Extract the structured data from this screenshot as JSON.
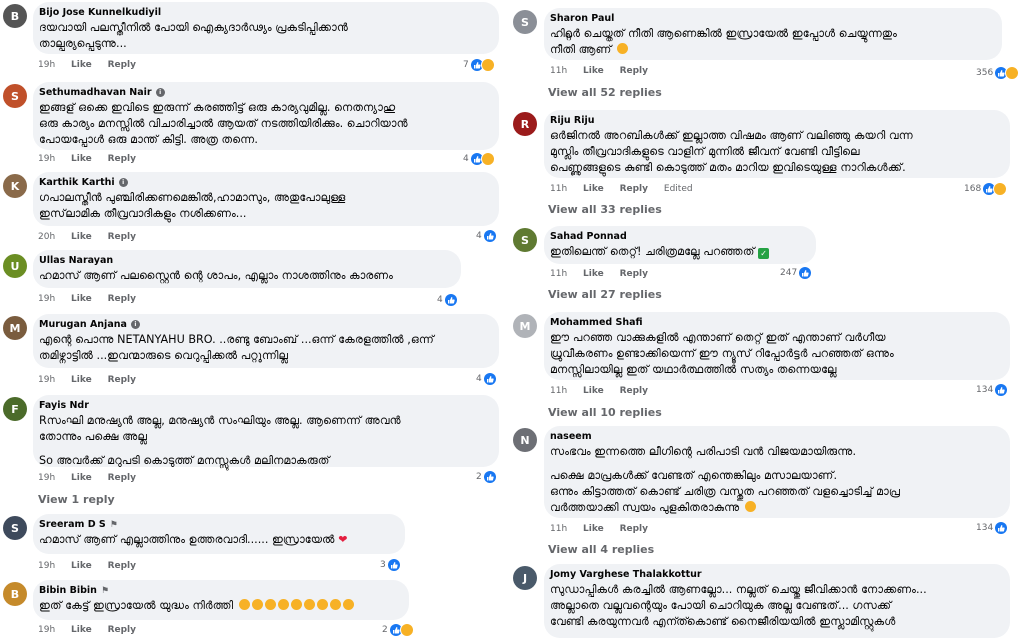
{
  "actions": {
    "like": "Like",
    "reply": "Reply",
    "edited": "Edited"
  },
  "colors": {
    "like_blue": "#1877f2",
    "haha_yellow": "#f7b125",
    "meta_gray": "#65676b",
    "bubble_bg": "#f0f2f5"
  },
  "left": [
    {
      "name": "Bijo Jose Kunnelkudiyil",
      "lines": [
        "ദയവായി പലസ്തീനിൽ പോയി ഐക്യദാർഢ്യം പ്രകടിപ്പിക്കാൻ",
        "താല്പര്യപ്പെടുന്നു..."
      ],
      "time": "19h",
      "count": "7",
      "icons": [
        "like-icon",
        "haha-icon"
      ]
    },
    {
      "name": "Sethumadhavan Nair",
      "lines": [
        "ഇങ്ങള് ഒക്കെ ഇവിടെ ഇരുന്ന് കരഞ്ഞിട്ട് ഒരു കാര്യവുമില്ല. നെതന്യാഹു",
        "ഒരു കാര്യം മനസ്സിൽ വിചാരിച്ചാൽ ആയത് നടത്തിയിരിക്കും. ചൊറിയാൻ",
        "പോയപ്പോൾ ഒരു മാന്ത് കിട്ടി. അത്ര തന്നെ."
      ],
      "time": "19h",
      "count": "4",
      "icons": [
        "like-icon",
        "haha-icon"
      ]
    },
    {
      "name": "Karthik Karthi",
      "lines": [
        "ഗപാലസ്തീൻ പുഞ്ചിരിക്കണമെങ്കിൽ,ഹാമാസും, അതുപോലുള്ള",
        "ഇസ്‌ലാമിക തീവ്രവാദികളും നശിക്കണം..."
      ],
      "time": "20h",
      "count": "4",
      "icons": [
        "like-icon"
      ]
    },
    {
      "name": "Ullas Narayan",
      "lines": [
        "ഹമാസ് ആണ് പലസ്റ്റൈൻ ന്റെ ശാപം, എല്ലാം നാശത്തിനും കാരണം"
      ],
      "time": "19h",
      "count": "4",
      "icons": [
        "like-icon"
      ]
    },
    {
      "name": "Murugan Anjana",
      "lines": [
        "എന്റെ പൊന്നു NETANYAHU BRO. ..രണ്ടു ബോംബ് ...ഒന്ന് കേരളത്തിൽ ,ഒന്ന്",
        "തമിഴ്നാട്ടിൽ ...ഇവന്മാരുടെ വെറുപ്പിക്കൽ പറ്റുന്നില്ല"
      ],
      "time": "19h",
      "count": "4",
      "icons": [
        "like-icon"
      ]
    },
    {
      "name": "Fayis Ndr",
      "lines": [
        "Rസംഘി മനുഷ്യൻ അല്ല, മനുഷ്യൻ സംഘിയും അല്ല. ആണെന്ന് അവൻ",
        "തോന്നും പക്ഷെ അല്ല"
      ],
      "extra": "So അവർക്ക് മറുപടി കൊടുത്ത് മനസ്സുകൾ മലിനമാകരുത്",
      "time": "19h",
      "count": "2",
      "icons": [
        "like-icon"
      ],
      "view_more": "View 1 reply"
    },
    {
      "name": "Sreeram D S",
      "lines": [
        "ഹമാസ് ആണ് എല്ലാത്തിനും ഉത്തരവാദി...... ഇസ്രായേൽ"
      ],
      "time": "19h",
      "count": "3",
      "icons": [
        "like-icon"
      ]
    },
    {
      "name": "Bibin Bibin",
      "lines": [
        "ഇത് കേട്ട് ഇസ്രായേൽ യുദ്ധം നിർത്തി"
      ],
      "time": "19h",
      "count": "2",
      "icons": [
        "like-icon",
        "haha-icon"
      ]
    }
  ],
  "right": [
    {
      "name": "Sharon Paul",
      "lines": [
        "ഹിറ്റ്ലർ ചെയ്തത് നീതി ആണെങ്കിൽ ഇസ്രായേൽ ഇപ്പോൾ ചെയ്യുന്നതും",
        "നീതി ആണ്"
      ],
      "time": "11h",
      "count": "356",
      "icons": [
        "like-icon",
        "haha-icon"
      ],
      "view_more": "View all 52 replies"
    },
    {
      "name": "Riju Riju",
      "lines": [
        "ഒർജിനൽ അറബികൾക്ക് ഇല്ലാത്ത വിഷമം ആണ് വലിഞ്ഞു കയറി വന്ന",
        "മുസ്ലിം തീവ്രവാദികളുടെ വാളിന് മുന്നിൽ ജീവന് വേണ്ടി വീട്ടിലെ",
        "പെണ്ണുങ്ങളുടെ കുണ്ടി കൊടുത്ത് മതം മാറിയ ഇവിടെയുള്ള നാറികൾക്ക്."
      ],
      "time": "11h",
      "count": "168",
      "icons": [
        "like-icon",
        "haha-icon"
      ],
      "edited": true,
      "view_more": "View all 33 replies"
    },
    {
      "name": "Sahad Ponnad",
      "lines": [
        "ഇതിലെന്ത് തെറ്റ്! ചരിത്രമല്ലേ പറഞ്ഞത്"
      ],
      "time": "11h",
      "count": "247",
      "icons": [
        "like-icon"
      ],
      "view_more": "View all 27 replies"
    },
    {
      "name": "Mohammed Shafi",
      "lines": [
        "ഈ പറഞ്ഞ വാക്കുകളിൽ എന്താണ് തെറ്റ് ഇത് എന്താണ് വർഗീയ",
        "ധ്രുവീകരണം ഉണ്ടാക്കിയെന്ന് ഈ ന്യൂസ് റിപ്പോർട്ടർ പറഞ്ഞത് ഒന്നും",
        "മനസ്സിലായില്ല ഇത് യഥാർത്ഥത്തിൽ സത്യം തന്നെയല്ലേ"
      ],
      "time": "11h",
      "count": "134",
      "icons": [
        "like-icon"
      ],
      "view_more": "View all 10 replies"
    },
    {
      "name": "naseem",
      "lines": [
        "സംഭവം ഇന്നത്തെ ലീഗിന്റെ പരിപാടി വൻ വിജയമായിരുന്നു."
      ],
      "extra_lines": [
        "പക്ഷെ മാപ്രകൾക്ക് വേണ്ടത് എന്തെങ്കിലും മസാലയാണ്.",
        "ഒന്നും കിട്ടാത്തത് കൊണ്ട് ചരിത്ര വസ്തുത പറഞ്ഞത് വളച്ചൊടിച്ച് മാപ്ര",
        "വർത്തയാക്കി സ്വയം പുളകിതരാകുന്നു"
      ],
      "time": "11h",
      "count": "134",
      "icons": [
        "like-icon"
      ],
      "view_more": "View all 4 replies"
    },
    {
      "name": "Jomy Varghese Thalakkottur",
      "lines": [
        "സുഡാപ്പികൾ കരച്ചിൽ ആണല്ലോ... നല്ലത് ചെയ്തു ജീവിക്കാൻ നോക്കണം...",
        "അല്ലാതെ വല്ലവന്റെയും പോയി ചൊറിയുക അല്ല വേണ്ടത്... ഗസക്ക്",
        "വേണ്ടി കരയുന്നവർ എന്ത്കൊണ്ട് നൈജീരിയയിൽ ഇസ്ലാമിസ്റ്റുകൾ"
      ]
    }
  ]
}
